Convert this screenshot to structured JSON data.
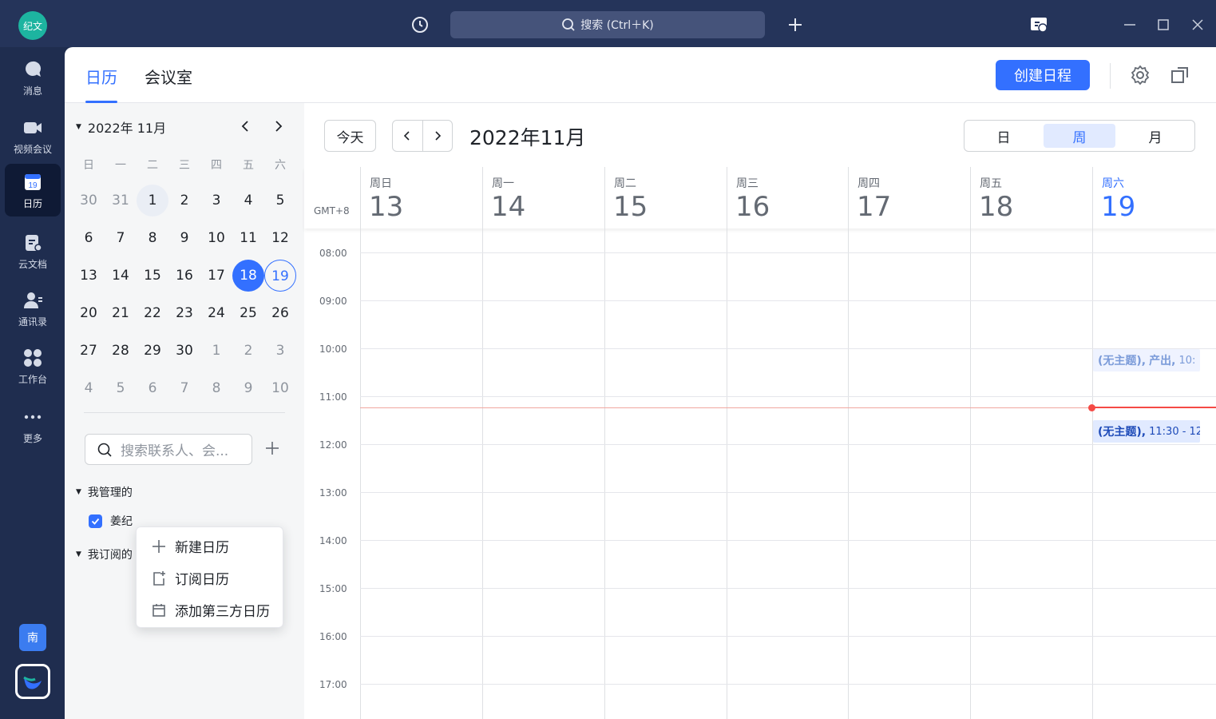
{
  "titlebar": {
    "app_logo_text": "纪文",
    "search_placeholder": "搜索 (Ctrl＋K)"
  },
  "leftnav": {
    "items": [
      {
        "label": "消息",
        "icon": "chat-icon"
      },
      {
        "label": "视频会议",
        "icon": "video-icon"
      },
      {
        "label": "日历",
        "icon": "calendar-icon",
        "badge": "19"
      },
      {
        "label": "云文档",
        "icon": "doc-icon"
      },
      {
        "label": "通讯录",
        "icon": "contacts-icon"
      },
      {
        "label": "工作台",
        "icon": "apps-icon"
      },
      {
        "label": "更多",
        "icon": "more-icon"
      }
    ],
    "user_badge": "南"
  },
  "topbar": {
    "tabs": [
      "日历",
      "会议室"
    ],
    "create_button": "创建日程"
  },
  "mini_calendar": {
    "month_label": "2022年 11月",
    "weekdays": [
      "日",
      "一",
      "二",
      "三",
      "四",
      "五",
      "六"
    ],
    "weeks": [
      [
        "30",
        "31",
        "1",
        "2",
        "3",
        "4",
        "5"
      ],
      [
        "6",
        "7",
        "8",
        "9",
        "10",
        "11",
        "12"
      ],
      [
        "13",
        "14",
        "15",
        "16",
        "17",
        "18",
        "19"
      ],
      [
        "20",
        "21",
        "22",
        "23",
        "24",
        "25",
        "26"
      ],
      [
        "27",
        "28",
        "29",
        "30",
        "1",
        "2",
        "3"
      ],
      [
        "4",
        "5",
        "6",
        "7",
        "8",
        "9",
        "10"
      ]
    ],
    "selected_day": "18",
    "today": "19"
  },
  "sidebar": {
    "search_placeholder": "搜索联系人、会...",
    "group_managed": "我管理的",
    "calendar_item": "姜纪",
    "group_subscribed": "我订阅的"
  },
  "add_menu": {
    "items": [
      "新建日历",
      "订阅日历",
      "添加第三方日历"
    ]
  },
  "calendar": {
    "today_button": "今天",
    "title": "2022年11月",
    "views": [
      "日",
      "周",
      "月"
    ],
    "active_view": "周",
    "timezone": "GMT+8",
    "days": [
      {
        "weekday": "周日",
        "date": "13"
      },
      {
        "weekday": "周一",
        "date": "14"
      },
      {
        "weekday": "周二",
        "date": "15"
      },
      {
        "weekday": "周三",
        "date": "16"
      },
      {
        "weekday": "周四",
        "date": "17"
      },
      {
        "weekday": "周五",
        "date": "18"
      },
      {
        "weekday": "周六",
        "date": "19"
      }
    ],
    "hours": [
      "08:00",
      "09:00",
      "10:00",
      "11:00",
      "12:00",
      "13:00",
      "14:00",
      "15:00",
      "16:00",
      "17:00"
    ],
    "events": [
      {
        "title": "(无主题),",
        "extra": "产出,",
        "time": "10:"
      },
      {
        "title": "(无主题),",
        "time": "11:30 - 12"
      }
    ]
  },
  "colors": {
    "accent": "#3370ff",
    "nav_bg": "#1f2d4f",
    "now_line": "#f54a45"
  }
}
